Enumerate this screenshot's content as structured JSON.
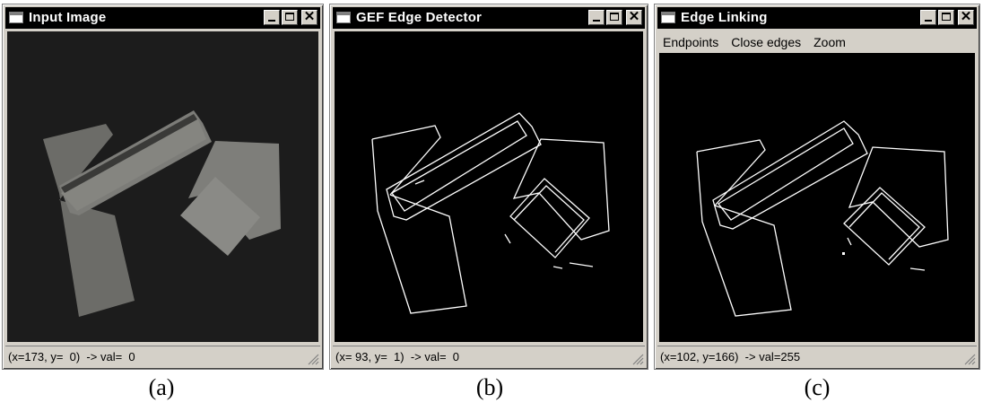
{
  "windows": [
    {
      "title": "Input Image",
      "status": "(x=173, y=  0)  -> val=  0",
      "caption": "(a)"
    },
    {
      "title": "GEF Edge Detector",
      "status": "(x= 93, y=  1)  -> val=  0",
      "caption": "(b)"
    },
    {
      "title": "Edge Linking",
      "menu": [
        "Endpoints",
        "Close edges",
        "Zoom"
      ],
      "status": "(x=102, y=166)  -> val=255",
      "caption": "(c)"
    }
  ],
  "colors": {
    "titlebar": "#000000",
    "window_face": "#d4d0c8",
    "canvas": "#000000",
    "object_gray": "#7a7a76",
    "edge": "#ffffff"
  }
}
